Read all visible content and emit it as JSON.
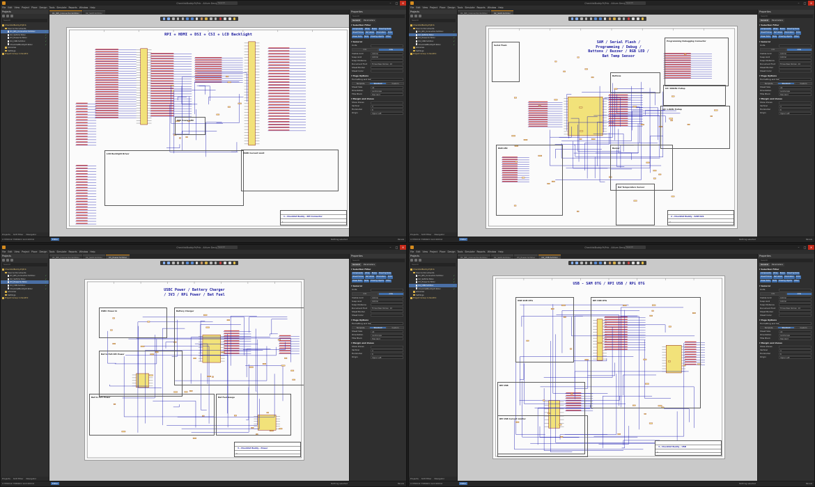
{
  "app_title": "Altium Designer (21.1.1)",
  "search_placeholder": "Search",
  "menu": [
    "File",
    "Edit",
    "View",
    "Project",
    "Place",
    "Design",
    "Tools",
    "Simulate",
    "Reports",
    "Window",
    "Help"
  ],
  "projects_panel": {
    "title": "Projects",
    "search_placeholder": "Search",
    "footer_tabs": [
      "Projects",
      "SCH Filter",
      "Navigator"
    ]
  },
  "properties_panel": {
    "title": "Properties",
    "search_placeholder": "Search",
    "tabs": [
      "General",
      "Parameters"
    ],
    "selection_filter_label": "Selection Filter",
    "filters": [
      "Components",
      "Wires",
      "Buses",
      "Sheet Symbols",
      "Sheet Entries",
      "Net Labels",
      "Parameters",
      "Ports",
      "Power Ports",
      "Texts",
      "Drawing objects",
      "Other"
    ],
    "general_label": "General",
    "units_label": "Units",
    "units": [
      "mm",
      "mils"
    ],
    "visible_grid_label": "Visible Grid",
    "visible_grid_value": "100mil",
    "snap_grid_label": "Snap Grid",
    "snap_grid_value": "100mil",
    "snap_distance_label": "Snap Distance",
    "document_font_label": "Document Font",
    "document_font_value": "Times New Roman, 10",
    "sheet_border_label": "Sheet Border",
    "sheet_color_label": "Sheet Color",
    "page_options_label": "Page Options",
    "formatting_label": "Formatting and Size",
    "formatting_options": [
      "Template",
      "Standard",
      "Custom"
    ],
    "sheet_size_label": "Sheet Size",
    "sheet_size_value": "A4",
    "orientation_label": "Orientation",
    "orientation_value": "Landscape",
    "title_block_label": "Title Block",
    "title_block_value": "Standard",
    "margin_label": "Margin and Zones",
    "show_zones_label": "Show Zones",
    "vertical_label": "Vertical",
    "vertical_value": "4",
    "horizontal_label": "Horizontal",
    "horizontal_value": "8",
    "origin_label": "Origin",
    "origin_value": "Upper Left"
  },
  "statusbar": {
    "left": "X:3700mil Y:5800mil  Grid:100mil",
    "editor_label": "Editor",
    "right": "Nothing selected",
    "panels_label": "Panels"
  },
  "windows": [
    {
      "title": "ChecklistBuddy.PrjPcb - Altium Designer (21.1.1)",
      "tabs": [
        "01_RPi_Connector.SchDoc",
        "02_SAM.SchDoc"
      ],
      "active_tab": 0,
      "sheet_title": "RPI + HDMI + DSI + CSI + LCD Backlight",
      "blocks": [
        "5V0 Power LED",
        "LCD Backlight Driver",
        "HDMI Current Limit"
      ],
      "title_block": "1 - Checklist Buddy - RPi Connector",
      "sheet_number": "1",
      "tree": [
        {
          "label": "ChecklistBuddy.PrjPcb",
          "kind": "grp",
          "indent": 0
        },
        {
          "label": "Source Documents",
          "kind": "fold",
          "indent": 1
        },
        {
          "label": "01_RPi_Connector.SchDoc",
          "kind": "doc",
          "indent": 2,
          "sel": true
        },
        {
          "label": "02_SAM.SchDoc",
          "kind": "doc",
          "indent": 2
        },
        {
          "label": "03_Power.SchDoc",
          "kind": "doc",
          "indent": 2
        },
        {
          "label": "04_USB.SchDoc",
          "kind": "doc",
          "indent": 2
        },
        {
          "label": "ChecklistBuddy.PcbDoc",
          "kind": "doc",
          "indent": 2
        },
        {
          "label": "Libraries",
          "kind": "fold",
          "indent": 1
        },
        {
          "label": "Settings",
          "kind": "fold",
          "indent": 1
        },
        {
          "label": "Project Group 1.DsnWrk",
          "kind": "grp",
          "indent": 0
        }
      ]
    },
    {
      "title": "ChecklistBuddy.PrjPcb - Altium Designer (21.1.1)",
      "tabs": [
        "01_RPi_Connector.SchDoc",
        "02_SAM.SchDoc"
      ],
      "active_tab": 1,
      "sheet_title": "SAM / Serial Flash /\nProgramming / Debug /\nButtons / Buzzer / RGB LED /\nBat Temp Sensor",
      "blocks": [
        "Serial Flash",
        "Programming Debugging Connector",
        "Buttons",
        "I2C 400kHz Pullup",
        "I2C 1.8kHz Pullup",
        "Buzzer",
        "Bat Temperature Sensor",
        "RGB LED"
      ],
      "title_block": "2 - Checklist Buddy - SAM D21",
      "sheet_number": "2",
      "tree": [
        {
          "label": "ChecklistBuddy.PrjPcb",
          "kind": "grp",
          "indent": 0
        },
        {
          "label": "Source Documents",
          "kind": "fold",
          "indent": 1
        },
        {
          "label": "01_RPi_Connector.SchDoc",
          "kind": "doc",
          "indent": 2
        },
        {
          "label": "02_SAM.SchDoc",
          "kind": "doc",
          "indent": 2,
          "sel": true
        },
        {
          "label": "03_Power.SchDoc",
          "kind": "doc",
          "indent": 2
        },
        {
          "label": "04_USB.SchDoc",
          "kind": "doc",
          "indent": 2
        },
        {
          "label": "ChecklistBuddy.PcbDoc",
          "kind": "doc",
          "indent": 2
        },
        {
          "label": "Libraries",
          "kind": "fold",
          "indent": 1
        },
        {
          "label": "Settings",
          "kind": "fold",
          "indent": 1
        },
        {
          "label": "Project Group 1.DsnWrk",
          "kind": "grp",
          "indent": 0
        }
      ]
    },
    {
      "title": "ChecklistBuddy.PrjPcb - Altium Designer (21.1.1)",
      "tabs": [
        "01_RPi_Connector.SchDoc",
        "02_SAM.SchDoc",
        "03_Power.SchDoc"
      ],
      "active_tab": 2,
      "sheet_title": "USBC Power / Battery Charger\n/ 3V3 / RPi Power / Bat Fuel",
      "blocks": [
        "USBC Power In",
        "Battery Charger",
        "Bat to 5V0 RPi Power",
        "Bat to 3V3 Power",
        "Bat Fuel Gauge"
      ],
      "title_block": "3 - Checklist Buddy - Power",
      "sheet_number": "3",
      "tree": [
        {
          "label": "ChecklistBuddy.PrjPcb",
          "kind": "grp",
          "indent": 0
        },
        {
          "label": "Source Documents",
          "kind": "fold",
          "indent": 1
        },
        {
          "label": "01_RPi_Connector.SchDoc",
          "kind": "doc",
          "indent": 2
        },
        {
          "label": "02_SAM.SchDoc",
          "kind": "doc",
          "indent": 2
        },
        {
          "label": "03_Power.SchDoc",
          "kind": "doc",
          "indent": 2,
          "sel": true
        },
        {
          "label": "04_USB.SchDoc",
          "kind": "doc",
          "indent": 2
        },
        {
          "label": "ChecklistBuddy.PcbDoc",
          "kind": "doc",
          "indent": 2
        },
        {
          "label": "Libraries",
          "kind": "fold",
          "indent": 1
        },
        {
          "label": "Settings",
          "kind": "fold",
          "indent": 1
        },
        {
          "label": "Project Group 1.DsnWrk",
          "kind": "grp",
          "indent": 0
        }
      ]
    },
    {
      "title": "ChecklistBuddy.PrjPcb - Altium Designer (21.1.1)",
      "tabs": [
        "01_RPi_Connector.SchDoc",
        "02_SAM.SchDoc",
        "03_Power.SchDoc",
        "04_USB.SchDoc"
      ],
      "active_tab": 3,
      "sheet_title": "USB - SAM OTG / RPI USB / RPi OTG",
      "blocks": [
        "USB SAM OTG",
        "RPI USB OTG",
        "RPI USB",
        "RPI USB Current Limiter"
      ],
      "title_block": "4 - Checklist Buddy - USB",
      "sheet_number": "4",
      "tree": [
        {
          "label": "ChecklistBuddy.PrjPcb",
          "kind": "grp",
          "indent": 0
        },
        {
          "label": "Source Documents",
          "kind": "fold",
          "indent": 1
        },
        {
          "label": "01_RPi_Connector.SchDoc",
          "kind": "doc",
          "indent": 2
        },
        {
          "label": "02_SAM.SchDoc",
          "kind": "doc",
          "indent": 2
        },
        {
          "label": "03_Power.SchDoc",
          "kind": "doc",
          "indent": 2
        },
        {
          "label": "04_USB.SchDoc",
          "kind": "doc",
          "indent": 2,
          "sel": true
        },
        {
          "label": "ChecklistBuddy.PcbDoc",
          "kind": "doc",
          "indent": 2
        },
        {
          "label": "Libraries",
          "kind": "fold",
          "indent": 1
        },
        {
          "label": "Settings",
          "kind": "fold",
          "indent": 1
        },
        {
          "label": "Project Group 1.DsnWrk",
          "kind": "grp",
          "indent": 0
        }
      ]
    }
  ],
  "colors": {
    "accent": "#d58b1e",
    "selection": "#4a6fa5",
    "filter_button": "#3f6fae",
    "title_ink": "#1a1a9e",
    "wire": "#1b1bb0",
    "component": "#f2e27a",
    "net_label": "#c02020"
  }
}
